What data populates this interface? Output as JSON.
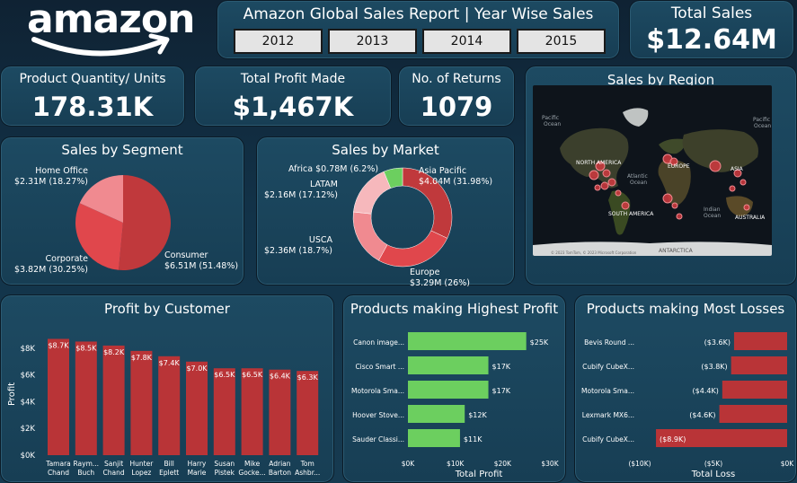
{
  "brand": {
    "name": "amazon"
  },
  "report": {
    "title": "Amazon Global Sales Report | Year Wise Sales",
    "years": [
      "2012",
      "2013",
      "2014",
      "2015"
    ]
  },
  "kpis": {
    "total_sales": {
      "label": "Total Sales",
      "value": "$12.64M"
    },
    "quantity": {
      "label": "Product Quantity/ Units",
      "value": "178.31K"
    },
    "profit": {
      "label": "Total Profit Made",
      "value": "$1,467K"
    },
    "returns": {
      "label": "No. of Returns",
      "value": "1079"
    }
  },
  "region_map": {
    "title": "Sales by Region",
    "labels": [
      {
        "text": "Pacific"
      },
      {
        "text": "Ocean"
      },
      {
        "text": "NORTH AMERICA"
      },
      {
        "text": "Atlantic"
      },
      {
        "text": "Ocean"
      },
      {
        "text": "EUROPE"
      },
      {
        "text": "ASIA"
      },
      {
        "text": "SOUTH AMERICA"
      },
      {
        "text": "Indian"
      },
      {
        "text": "Ocean"
      },
      {
        "text": "AUSTRALIA"
      },
      {
        "text": "ANTARCTICA"
      },
      {
        "text": "Pacific"
      },
      {
        "text": "Ocean"
      }
    ],
    "footer": "© 2023 TomTom, © 2023 Microsoft Corporation"
  },
  "colors": {
    "red": "#c0393c",
    "red_dark": "#b93437",
    "red_mid": "#e0474c",
    "pink": "#f08a90",
    "pink_light": "#f4b2b6",
    "green": "#6ccf5f"
  },
  "chart_data": [
    {
      "id": "segment",
      "type": "pie",
      "title": "Sales by Segment",
      "slices": [
        {
          "name": "Consumer",
          "value": 6.51,
          "label": "$6.51M (51.48%)",
          "color": "#c0393c"
        },
        {
          "name": "Corporate",
          "value": 3.82,
          "label": "$3.82M (30.25%)",
          "color": "#e0474c"
        },
        {
          "name": "Home Office",
          "value": 2.31,
          "label": "$2.31M (18.27%)",
          "color": "#f08a90"
        }
      ]
    },
    {
      "id": "market",
      "type": "pie",
      "title": "Sales by Market",
      "slices": [
        {
          "name": "Asia Pacific",
          "value": 4.04,
          "label": "$4.04M (31.98%)",
          "color": "#c0393c"
        },
        {
          "name": "Europe",
          "value": 3.29,
          "label": "$3.29M (26%)",
          "color": "#e0474c"
        },
        {
          "name": "USCA",
          "value": 2.36,
          "label": "$2.36M (18.7%)",
          "color": "#f08a90"
        },
        {
          "name": "LATAM",
          "value": 2.16,
          "label": "$2.16M (17.12%)",
          "color": "#f6b8bc"
        },
        {
          "name": "Africa",
          "value": 0.78,
          "label": "$0.78M (6.2%)",
          "color": "#6ccf5f"
        }
      ]
    },
    {
      "id": "customer",
      "type": "bar",
      "title": "Profit by Customer",
      "ylabel": "Profit",
      "ylim": [
        0,
        9000
      ],
      "yticks": [
        "$0K",
        "$2K",
        "$4K",
        "$6K",
        "$8K"
      ],
      "categories": [
        [
          "Tamara",
          "Chand"
        ],
        [
          "Raym...",
          "Buch"
        ],
        [
          "Sanjit",
          "Chand"
        ],
        [
          "Hunter",
          "Lopez"
        ],
        [
          "Bill",
          "Eplett"
        ],
        [
          "Harry",
          "Marie"
        ],
        [
          "Susan",
          "Pistek"
        ],
        [
          "Mike",
          "Gocke..."
        ],
        [
          "Adrian",
          "Barton"
        ],
        [
          "Tom",
          "Ashbr..."
        ]
      ],
      "values": [
        8700,
        8500,
        8200,
        7800,
        7400,
        7000,
        6500,
        6500,
        6400,
        6300
      ],
      "labels": [
        "$8.7K",
        "$8.5K",
        "$8.2K",
        "$7.8K",
        "$7.4K",
        "$7.0K",
        "$6.5K",
        "$6.5K",
        "$6.4K",
        "$6.3K"
      ]
    },
    {
      "id": "top_profit",
      "type": "bar",
      "orientation": "horizontal",
      "title": "Products making Highest Profit",
      "xlabel": "Total Profit",
      "xlim": [
        0,
        30000
      ],
      "xticks": [
        "$0K",
        "$10K",
        "$20K",
        "$30K"
      ],
      "categories": [
        "Canon image...",
        "Cisco Smart ...",
        "Motorola Sma...",
        "Hoover Stove...",
        "Sauder Classi..."
      ],
      "values": [
        25000,
        17000,
        17000,
        12000,
        11000
      ],
      "labels": [
        "$25K",
        "$17K",
        "$17K",
        "$12K",
        "$11K"
      ]
    },
    {
      "id": "top_losses",
      "type": "bar",
      "orientation": "horizontal",
      "title": "Products making Most Losses",
      "xlabel": "Total Loss",
      "xlim": [
        -10000,
        0
      ],
      "xticks": [
        "($10K)",
        "($5K)",
        "$0K"
      ],
      "categories": [
        "Bevis Round ...",
        "Cubify CubeX...",
        "Motorola Sma...",
        "Lexmark MX6...",
        "Cubify CubeX..."
      ],
      "values": [
        -3600,
        -3800,
        -4400,
        -4600,
        -8900
      ],
      "labels": [
        "($3.6K)",
        "($3.8K)",
        "($4.4K)",
        "($4.6K)",
        "($8.9K)"
      ]
    }
  ]
}
